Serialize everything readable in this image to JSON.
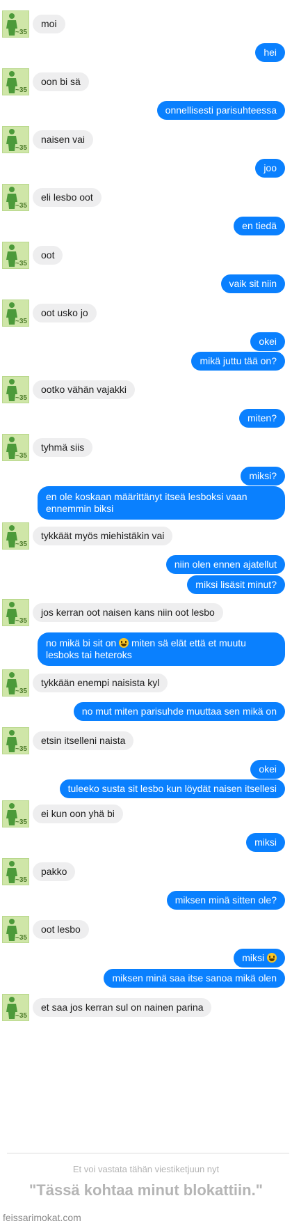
{
  "avatar_label": "~35",
  "messages": [
    {
      "from": "them",
      "text": "moi"
    },
    {
      "from": "me",
      "text": "hei"
    },
    {
      "from": "them",
      "text": "oon bi sä"
    },
    {
      "from": "me",
      "text": "onnellisesti parisuhteessa"
    },
    {
      "from": "them",
      "text": "naisen vai"
    },
    {
      "from": "me",
      "text": "joo"
    },
    {
      "from": "them",
      "text": "eli lesbo oot"
    },
    {
      "from": "me",
      "text": "en tiedä"
    },
    {
      "from": "them",
      "text": "oot"
    },
    {
      "from": "me",
      "text": "vaik sit niin"
    },
    {
      "from": "them",
      "text": "oot usko jo"
    },
    {
      "from": "me",
      "text": "okei"
    },
    {
      "from": "me",
      "text": "mikä juttu tää on?"
    },
    {
      "from": "them",
      "text": "ootko vähän vajakki"
    },
    {
      "from": "me",
      "text": "miten?"
    },
    {
      "from": "them",
      "text": "tyhmä siis"
    },
    {
      "from": "me",
      "text": "miksi?"
    },
    {
      "from": "me",
      "text": "en ole koskaan määrittänyt itseä lesboksi vaan ennemmin biksi"
    },
    {
      "from": "them",
      "text": "tykkäät myös miehistäkin vai"
    },
    {
      "from": "me",
      "text": "niin olen ennen ajatellut"
    },
    {
      "from": "me",
      "text": "miksi lisäsit minut?"
    },
    {
      "from": "them",
      "text": "jos kerran oot naisen kans niin oot lesbo"
    },
    {
      "from": "me",
      "text_before": "no mikä bi sit on",
      "emoji": "grinning-face",
      "text_after": "miten sä elät että et muutu lesboks tai heteroks"
    },
    {
      "from": "them",
      "text": "tykkään enempi naisista kyl"
    },
    {
      "from": "me",
      "text": "no mut miten parisuhde muuttaa sen mikä on"
    },
    {
      "from": "them",
      "text": "etsin itselleni naista"
    },
    {
      "from": "me",
      "text": "okei"
    },
    {
      "from": "me",
      "text": "tuleeko susta sit lesbo kun löydät naisen itsellesi"
    },
    {
      "from": "them",
      "text": "ei kun oon yhä bi"
    },
    {
      "from": "me",
      "text": "miksi"
    },
    {
      "from": "them",
      "text": "pakko"
    },
    {
      "from": "me",
      "text": "miksen minä sitten ole?"
    },
    {
      "from": "them",
      "text": "oot lesbo"
    },
    {
      "from": "me",
      "text": "miksi",
      "emoji": "grinning-face"
    },
    {
      "from": "me",
      "text": "miksen minä saa itse sanoa mikä olen"
    },
    {
      "from": "them",
      "text": "et saa jos kerran sul on nainen parina"
    }
  ],
  "footer": {
    "notice": "Et voi vastata tähän viestiketjuun nyt",
    "caption": "\"Tässä kohtaa minut blokattiin.\"",
    "watermark": "feissarimokat.com"
  },
  "colors": {
    "outgoing_bubble": "#0a80fe",
    "incoming_bubble": "#eeeeef",
    "avatar_bg": "#cfe6a8"
  }
}
